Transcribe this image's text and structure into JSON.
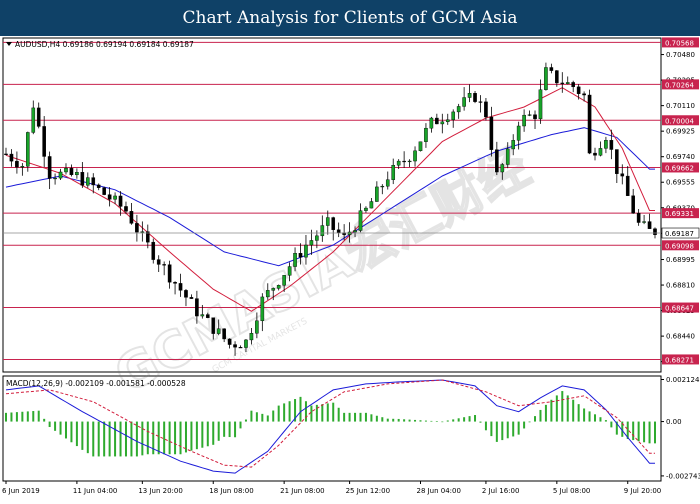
{
  "header": {
    "title": "Chart Analysis for Clients of GCM Asia"
  },
  "watermark": {
    "text": "GCMASIA宏汇财经",
    "subtext": "GCM CAPITAL MARKETS"
  },
  "chart_data": {
    "type": "candlestick",
    "symbol_line": "AUDUSD,H4  0.69186 0.69194 0.69184 0.69187",
    "current_price": "0.69187",
    "price_axis": {
      "ylim": [
        0.6818,
        0.706
      ],
      "ticks": [
        "0.70480",
        "0.70295",
        "0.70110",
        "0.69925",
        "0.69740",
        "0.69555",
        "0.69370",
        "0.69185",
        "0.68995",
        "0.68810",
        "0.68625",
        "0.68440",
        "0.68255"
      ]
    },
    "levels": [
      {
        "label": "0.70568",
        "value": 0.70568
      },
      {
        "label": "0.70264",
        "value": 0.70264
      },
      {
        "label": "0.70004",
        "value": 0.70004
      },
      {
        "label": "0.69662",
        "value": 0.69662
      },
      {
        "label": "0.69331",
        "value": 0.69331
      },
      {
        "label": "0.69098",
        "value": 0.69098
      },
      {
        "label": "0.68647",
        "value": 0.68647
      },
      {
        "label": "0.68271",
        "value": 0.68271
      }
    ],
    "x_labels": [
      "6 Jun 2019",
      "11 Jun 04:00",
      "13 Jun 20:00",
      "18 Jun 08:00",
      "21 Jun 08:00",
      "25 Jun 12:00",
      "28 Jun 04:00",
      "2 Jul 16:00",
      "5 Jul 08:00",
      "9 Jul 20:00"
    ],
    "price_anchors": [
      [
        0,
        0.6976
      ],
      [
        3,
        0.6968
      ],
      [
        5,
        0.7012
      ],
      [
        8,
        0.6962
      ],
      [
        13,
        0.696
      ],
      [
        17,
        0.695
      ],
      [
        22,
        0.6935
      ],
      [
        25,
        0.6915
      ],
      [
        30,
        0.6888
      ],
      [
        35,
        0.6862
      ],
      [
        38,
        0.685
      ],
      [
        41,
        0.6838
      ],
      [
        44,
        0.684
      ],
      [
        47,
        0.687
      ],
      [
        51,
        0.689
      ],
      [
        55,
        0.691
      ],
      [
        59,
        0.6925
      ],
      [
        62,
        0.6915
      ],
      [
        66,
        0.6935
      ],
      [
        70,
        0.696
      ],
      [
        74,
        0.6975
      ],
      [
        78,
        0.6998
      ],
      [
        82,
        0.7008
      ],
      [
        86,
        0.7018
      ],
      [
        88,
        0.7005
      ],
      [
        90,
        0.696
      ],
      [
        92,
        0.6975
      ],
      [
        94,
        0.7
      ],
      [
        97,
        0.7005
      ],
      [
        99,
        0.7035
      ],
      [
        101,
        0.703
      ],
      [
        104,
        0.7025
      ],
      [
        106,
        0.7018
      ],
      [
        107,
        0.6975
      ],
      [
        110,
        0.699
      ],
      [
        112,
        0.6965
      ],
      [
        114,
        0.6945
      ],
      [
        116,
        0.6925
      ],
      [
        118,
        0.692
      ]
    ],
    "ma_red": [
      [
        0,
        0.6975
      ],
      [
        10,
        0.6962
      ],
      [
        20,
        0.694
      ],
      [
        30,
        0.6905
      ],
      [
        38,
        0.6878
      ],
      [
        45,
        0.6862
      ],
      [
        52,
        0.688
      ],
      [
        60,
        0.6905
      ],
      [
        70,
        0.6945
      ],
      [
        80,
        0.6985
      ],
      [
        88,
        0.7002
      ],
      [
        95,
        0.701
      ],
      [
        102,
        0.7024
      ],
      [
        108,
        0.701
      ],
      [
        113,
        0.698
      ],
      [
        118,
        0.6935
      ]
    ],
    "ma_blue": [
      [
        0,
        0.6952
      ],
      [
        10,
        0.696
      ],
      [
        20,
        0.695
      ],
      [
        30,
        0.693
      ],
      [
        40,
        0.6905
      ],
      [
        50,
        0.6895
      ],
      [
        60,
        0.691
      ],
      [
        70,
        0.6935
      ],
      [
        80,
        0.696
      ],
      [
        90,
        0.6978
      ],
      [
        100,
        0.699
      ],
      [
        106,
        0.6995
      ],
      [
        112,
        0.6988
      ],
      [
        118,
        0.6965
      ]
    ],
    "macd": {
      "label": "MACD(12,26,9) -0.002109 -0.001581 -0.000528",
      "ticks": [
        "0.002124",
        "0.00",
        "-0.002743"
      ],
      "ylim": [
        -0.003,
        0.0023
      ],
      "main_anchors": [
        [
          0,
          0.0016
        ],
        [
          6,
          0.0018
        ],
        [
          14,
          0.0005
        ],
        [
          24,
          -0.001
        ],
        [
          32,
          -0.002
        ],
        [
          38,
          -0.0025
        ],
        [
          42,
          -0.0026
        ],
        [
          48,
          -0.0015
        ],
        [
          54,
          0.0005
        ],
        [
          60,
          0.0016
        ],
        [
          66,
          0.0019
        ],
        [
          72,
          0.002
        ],
        [
          80,
          0.0021
        ],
        [
          86,
          0.0018
        ],
        [
          90,
          0.0008
        ],
        [
          94,
          0.0005
        ],
        [
          98,
          0.0012
        ],
        [
          102,
          0.0018
        ],
        [
          106,
          0.0016
        ],
        [
          110,
          0.0006
        ],
        [
          114,
          -0.0008
        ],
        [
          118,
          -0.0021
        ]
      ],
      "signal_anchors": [
        [
          0,
          0.0014
        ],
        [
          8,
          0.0016
        ],
        [
          16,
          0.001
        ],
        [
          26,
          -0.0005
        ],
        [
          34,
          -0.0015
        ],
        [
          40,
          -0.0022
        ],
        [
          45,
          -0.0023
        ],
        [
          50,
          -0.0012
        ],
        [
          56,
          0.0005
        ],
        [
          62,
          0.0015
        ],
        [
          70,
          0.0019
        ],
        [
          80,
          0.0021
        ],
        [
          88,
          0.0015
        ],
        [
          94,
          0.0008
        ],
        [
          100,
          0.001
        ],
        [
          106,
          0.0013
        ],
        [
          112,
          0.0002
        ],
        [
          118,
          -0.0016
        ]
      ]
    }
  }
}
